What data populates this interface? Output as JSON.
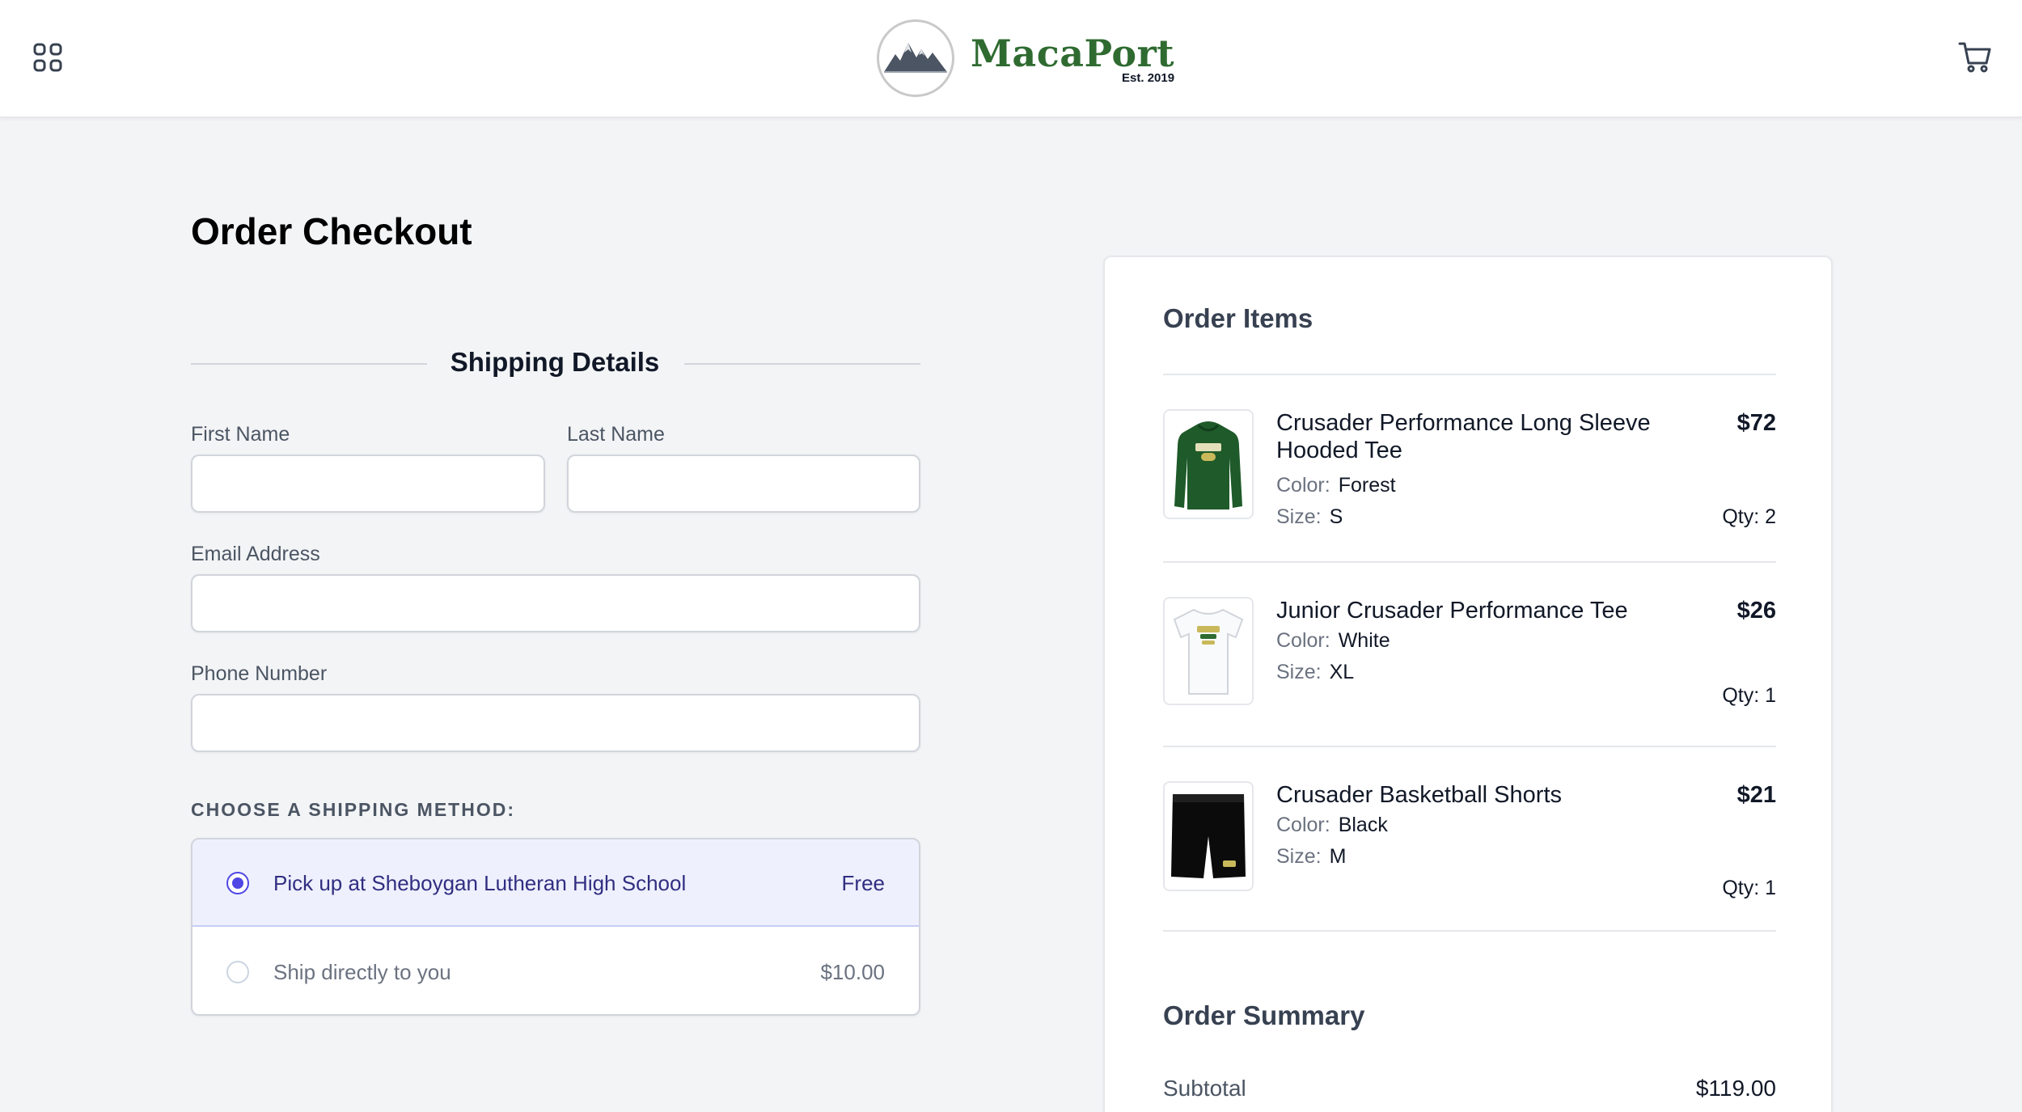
{
  "header": {
    "menu_icon": "grid-icon",
    "brand_name": "MacaPort",
    "brand_established": "Est. 2019",
    "cart_icon": "cart-icon"
  },
  "checkout": {
    "title": "Order Checkout",
    "section_title": "Shipping Details",
    "fields": {
      "first_name": {
        "label": "First Name",
        "value": "",
        "placeholder": ""
      },
      "last_name": {
        "label": "Last Name",
        "value": "",
        "placeholder": ""
      },
      "email": {
        "label": "Email Address",
        "value": "",
        "placeholder": ""
      },
      "phone": {
        "label": "Phone Number",
        "value": "",
        "placeholder": ""
      }
    },
    "shipping": {
      "caption": "CHOOSE A SHIPPING METHOD:",
      "options": [
        {
          "label": "Pick up at Sheboygan Lutheran High School",
          "price": "Free",
          "selected": true
        },
        {
          "label": "Ship directly to you",
          "price": "$10.00",
          "selected": false
        }
      ]
    }
  },
  "order": {
    "items_title": "Order Items",
    "color_key": "Color:",
    "size_key": "Size:",
    "items": [
      {
        "name": "Crusader Performance Long Sleeve Hooded Tee",
        "price": "$72",
        "color": "Forest",
        "size": "S",
        "qty": "Qty: 2",
        "image": "green-hoodie"
      },
      {
        "name": "Junior Crusader Performance Tee",
        "price": "$26",
        "color": "White",
        "size": "XL",
        "qty": "Qty: 1",
        "image": "white-tee"
      },
      {
        "name": "Crusader Basketball Shorts",
        "price": "$21",
        "color": "Black",
        "size": "M",
        "qty": "Qty: 1",
        "image": "black-shorts"
      }
    ],
    "summary_title": "Order Summary",
    "subtotal_label": "Subtotal",
    "subtotal_value": "$119.00"
  },
  "colors": {
    "brand": "#2f6b31",
    "accent": "#4f46e5",
    "selected_bg": "#eef0fd",
    "page_bg": "#f3f4f6"
  }
}
